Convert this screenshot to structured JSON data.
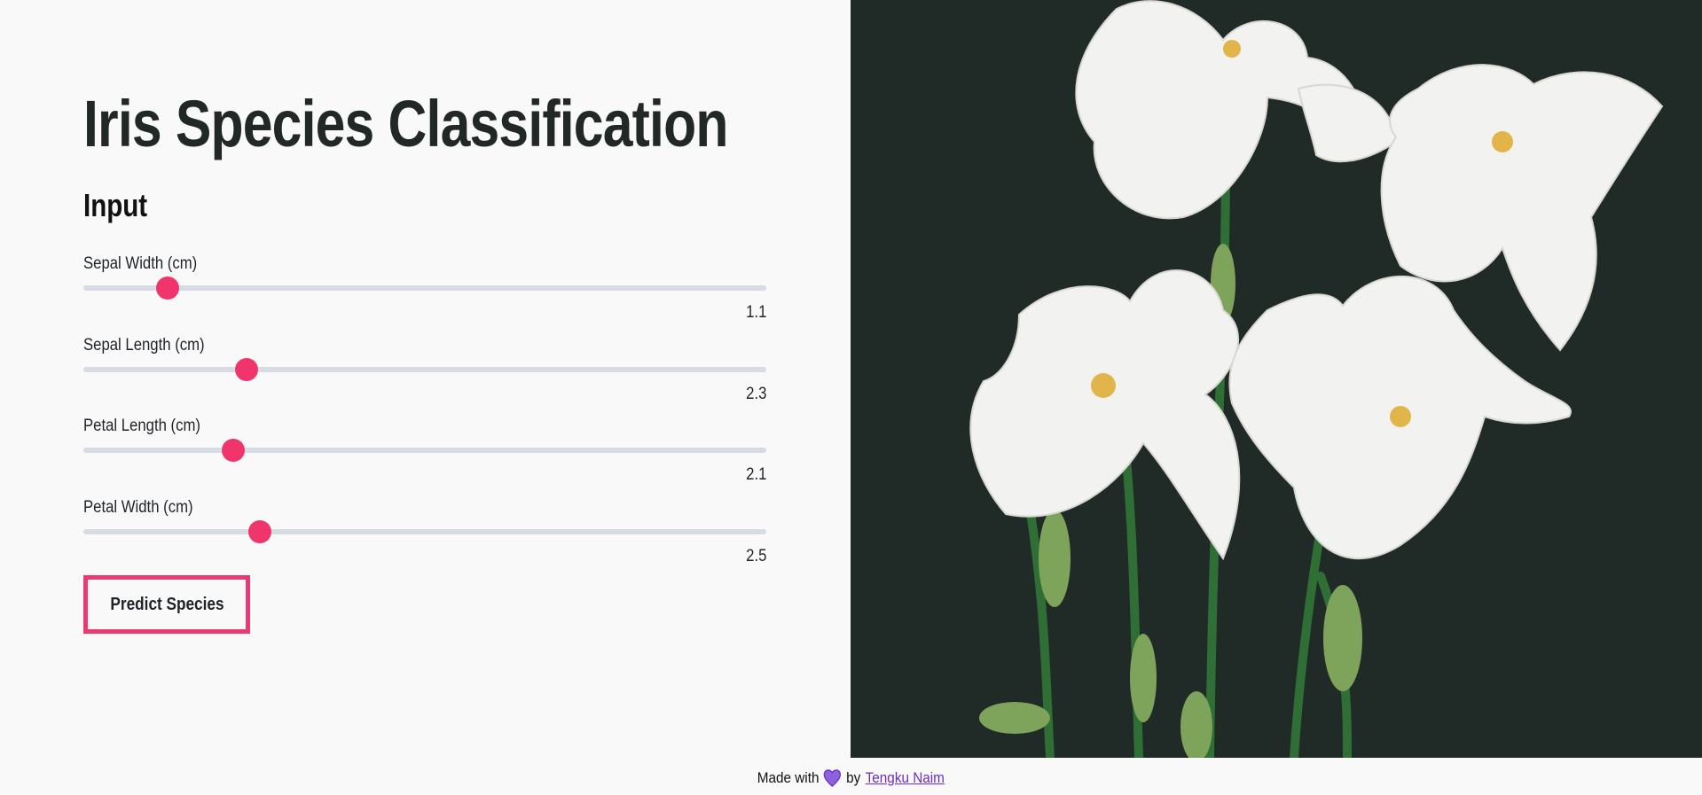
{
  "page": {
    "title": "Iris Species Classification",
    "section_title": "Input"
  },
  "inputs": {
    "sepal_width": {
      "label": "Sepal Width (cm)",
      "value": "1.1",
      "level": 0.123
    },
    "sepal_length": {
      "label": "Sepal Length (cm)",
      "value": "2.3",
      "level": 0.239
    },
    "petal_length": {
      "label": "Petal Length (cm)",
      "value": "2.1",
      "level": 0.219
    },
    "petal_width": {
      "label": "Petal Width (cm)",
      "value": "2.5",
      "level": 0.258
    }
  },
  "actions": {
    "predict_label": "Predict Species"
  },
  "footer": {
    "made_with": "Made with",
    "by": "by",
    "author": "Tengku Naim",
    "heart_icon": "heart-icon"
  },
  "colors": {
    "accent": "#f0356d",
    "button_border": "#ea3a72",
    "link": "#6b2fbd",
    "image_background": "#202a27"
  }
}
